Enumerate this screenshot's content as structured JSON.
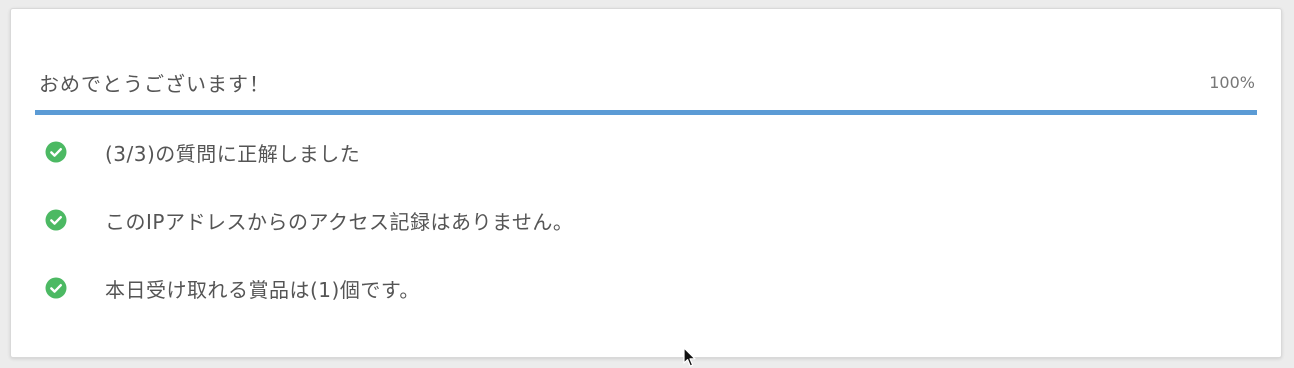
{
  "result": {
    "title": "おめでとうございます！",
    "percent_label": "100%",
    "progress": 1.0,
    "accent_color": "#5b9bd5",
    "check_color": "#4cb963"
  },
  "checklist": [
    {
      "icon": "check-circle-icon",
      "text": "(3/3)の質問に正解しました"
    },
    {
      "icon": "check-circle-icon",
      "text": "このIPアドレスからのアクセス記録はありません。"
    },
    {
      "icon": "check-circle-icon",
      "text": "本日受け取れる賞品は(1)個です。"
    }
  ]
}
